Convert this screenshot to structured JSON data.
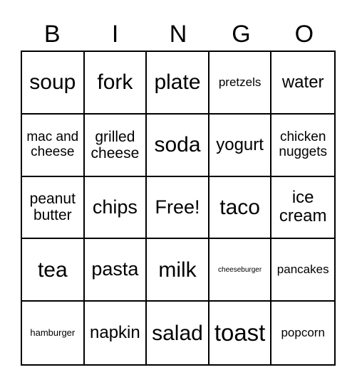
{
  "card": {
    "header": [
      "B",
      "I",
      "N",
      "G",
      "O"
    ],
    "rows": [
      [
        "soup",
        "fork",
        "plate",
        "pretzels",
        "water"
      ],
      [
        "mac and cheese",
        "grilled cheese",
        "soda",
        "yogurt",
        "chicken nuggets"
      ],
      [
        "peanut butter",
        "chips",
        "Free!",
        "taco",
        "ice cream"
      ],
      [
        "tea",
        "pasta",
        "milk",
        "cheeseburger",
        "pancakes"
      ],
      [
        "hamburger",
        "napkin",
        "salad",
        "toast",
        "popcorn"
      ]
    ]
  }
}
